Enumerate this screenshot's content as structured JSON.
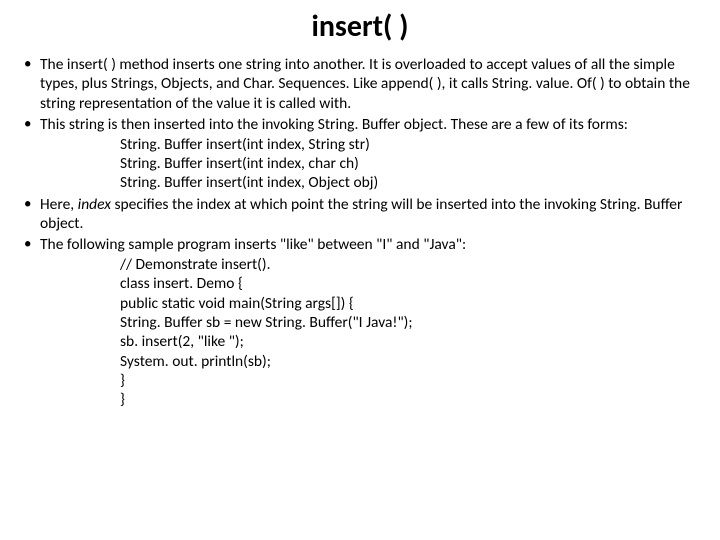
{
  "title": "insert( )",
  "bullets": [
    {
      "text": "The insert( ) method inserts one string into another. It is overloaded to accept values of all the simple types, plus Strings, Objects, and Char. Sequences. Like append( ), it calls String. value. Of( ) to obtain the string representation of the value it is called with."
    },
    {
      "text": "This string is then inserted into the invoking String. Buffer object. These are a few of its forms:",
      "forms": [
        "String. Buffer insert(int index, String str)",
        "String. Buffer insert(int index, char ch)",
        "String. Buffer insert(int index, Object obj)"
      ]
    },
    {
      "text_prefix": "Here, ",
      "text_italic": "index ",
      "text_mid": "specifies the index at which point the string will be inserted into the invoking String. Buffer object."
    },
    {
      "text": "The following sample program inserts \"like\" between \"I\" and \"Java\":",
      "code": [
        "// Demonstrate insert().",
        "class insert. Demo {",
        "public static void main(String args[]) {",
        "String. Buffer sb = new String. Buffer(\"I Java!\");",
        "sb. insert(2, \"like \");",
        "System. out. println(sb);",
        "}",
        "}"
      ]
    }
  ]
}
